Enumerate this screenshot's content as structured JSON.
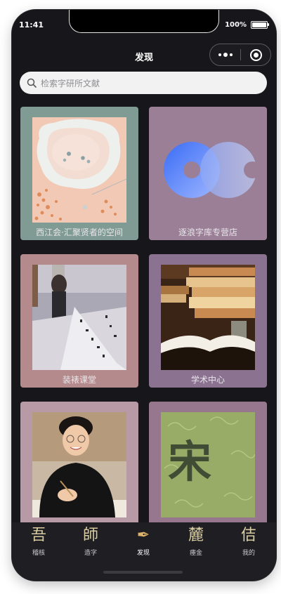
{
  "status": {
    "time": "11:41",
    "battery": "100%",
    "battery_level": 1.0
  },
  "nav": {
    "title": "发现"
  },
  "search": {
    "placeholder": "检索字研所文献"
  },
  "cards": [
    {
      "label": "西江会·汇聚贤者的空间",
      "bg": "#7f9b93",
      "image": "pearl-earrings-photo"
    },
    {
      "label": "逐浪字库专营店",
      "bg": "#9b7f97",
      "image": "blue-infinity-logo"
    },
    {
      "label": "装裱课堂",
      "bg": "#b58a8c",
      "image": "calligraphy-mounting-photo"
    },
    {
      "label": "学术中心",
      "bg": "#8a7290",
      "image": "open-books-photo"
    },
    {
      "label": "",
      "bg": "#b89aa6",
      "image": "smiling-woman-portrait"
    },
    {
      "label": "",
      "bg": "#96778e",
      "image": "song-character-green-tile",
      "character": "宋"
    }
  ],
  "tabs": [
    {
      "label": "稽核",
      "glyph": "吾",
      "icon": "calligraphy-wu-icon"
    },
    {
      "label": "造字",
      "glyph": "師",
      "icon": "calligraphy-shi-icon"
    },
    {
      "label": "发现",
      "glyph": "✒",
      "icon": "brush-discover-icon",
      "active": true
    },
    {
      "label": "瘗金",
      "glyph": "麓",
      "icon": "calligraphy-lu-icon"
    },
    {
      "label": "我的",
      "glyph": "佶",
      "icon": "calligraphy-ji-icon"
    }
  ]
}
